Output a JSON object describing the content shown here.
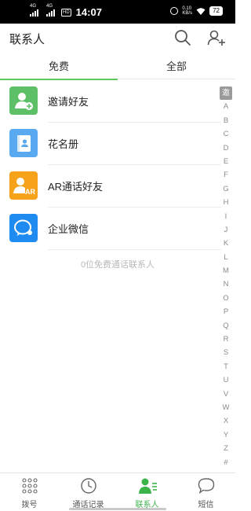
{
  "status_bar": {
    "signal1": "4G",
    "signal2": "4G",
    "hd": "HD",
    "time": "14:07",
    "net_speed_value": "0.10",
    "net_speed_unit": "KB/s",
    "battery": "72"
  },
  "header": {
    "title": "联系人"
  },
  "tabs": [
    {
      "label": "免费",
      "active": true
    },
    {
      "label": "全部",
      "active": false
    }
  ],
  "contacts": [
    {
      "label": "邀请好友",
      "icon": "add-contact-icon",
      "color": "#5ec066"
    },
    {
      "label": "花名册",
      "icon": "roster-book-icon",
      "color": "#59a9f0"
    },
    {
      "label": "AR通话好友",
      "icon": "ar-contact-icon",
      "color": "#f7a21b"
    },
    {
      "label": "企业微信",
      "icon": "wecom-icon",
      "color": "#1f8af0"
    }
  ],
  "empty_text": "0位免费通话联系人",
  "index": [
    "邀",
    "A",
    "B",
    "C",
    "D",
    "E",
    "F",
    "G",
    "H",
    "I",
    "J",
    "K",
    "L",
    "M",
    "N",
    "O",
    "P",
    "Q",
    "R",
    "S",
    "T",
    "U",
    "V",
    "W",
    "X",
    "Y",
    "Z",
    "#"
  ],
  "index_selected": "邀",
  "bottom_nav": [
    {
      "label": "拨号",
      "icon": "dialpad-icon",
      "active": false
    },
    {
      "label": "通话记录",
      "icon": "clock-icon",
      "active": false
    },
    {
      "label": "联系人",
      "icon": "contacts-icon",
      "active": true
    },
    {
      "label": "短信",
      "icon": "message-icon",
      "active": false
    }
  ],
  "colors": {
    "accent": "#3db44a",
    "tab_indicator": "#5ec95e"
  }
}
